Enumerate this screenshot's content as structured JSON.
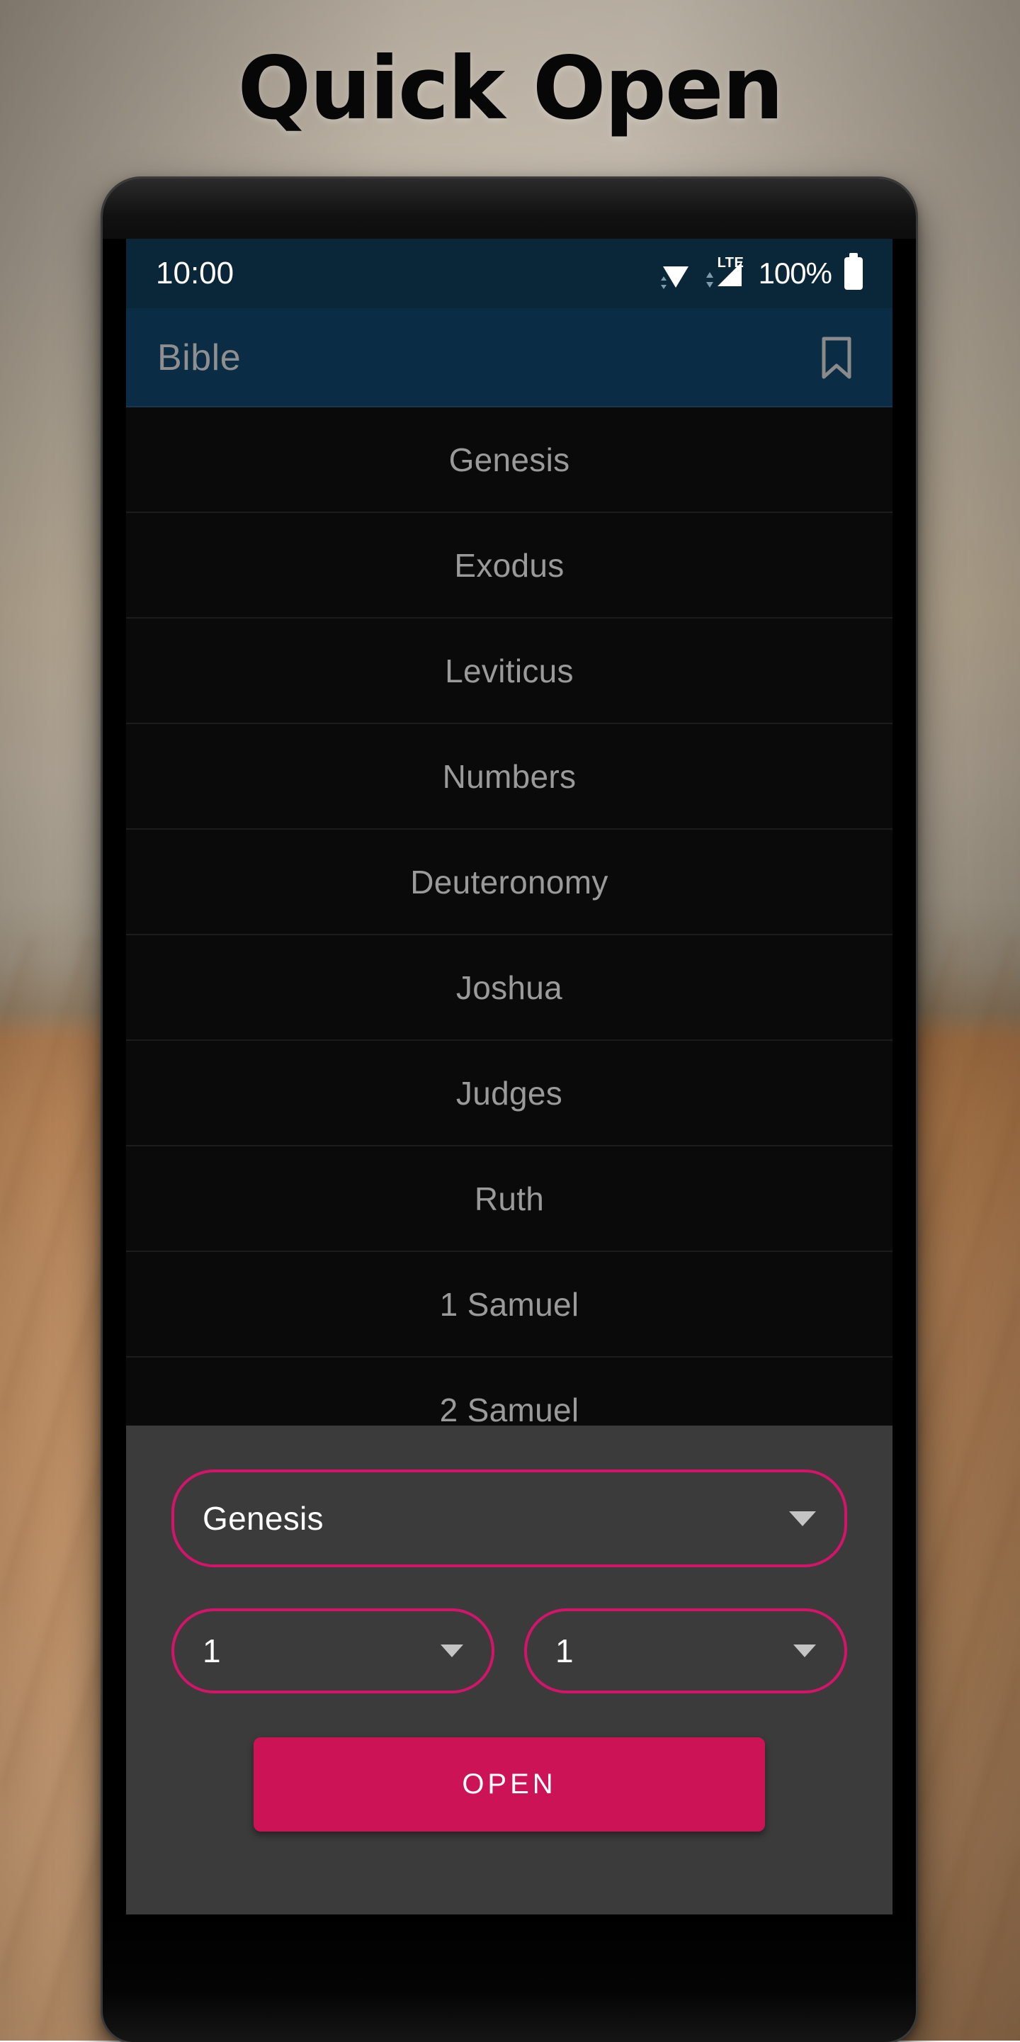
{
  "page": {
    "headline": "Quick Open"
  },
  "status_bar": {
    "time": "10:00",
    "battery_percent": "100%",
    "network_label": "LTE",
    "icons": [
      "wifi-icon",
      "lte-signal-icon",
      "battery-icon"
    ]
  },
  "app_bar": {
    "title": "Bible",
    "action_icon": "bookmark-icon"
  },
  "book_list": {
    "items": [
      {
        "label": "Genesis"
      },
      {
        "label": "Exodus"
      },
      {
        "label": "Leviticus"
      },
      {
        "label": "Numbers"
      },
      {
        "label": "Deuteronomy"
      },
      {
        "label": "Joshua"
      },
      {
        "label": "Judges"
      },
      {
        "label": "Ruth"
      },
      {
        "label": "1 Samuel"
      },
      {
        "label": "2 Samuel"
      }
    ]
  },
  "quick_open_panel": {
    "book_select": {
      "value": "Genesis",
      "caret_icon": "chevron-down-icon"
    },
    "chapter_select": {
      "value": "1",
      "caret_icon": "chevron-down-icon"
    },
    "verse_select": {
      "value": "1",
      "caret_icon": "chevron-down-icon"
    },
    "open_button_label": "OPEN"
  },
  "colors": {
    "accent": "#cc1356",
    "accent_border": "#d4146a",
    "app_bar": "#0a2c44",
    "status_bar": "#0a2639",
    "panel": "#3b3b3b",
    "list_bg": "#0a0a0a",
    "list_text": "#9a9a9a"
  }
}
